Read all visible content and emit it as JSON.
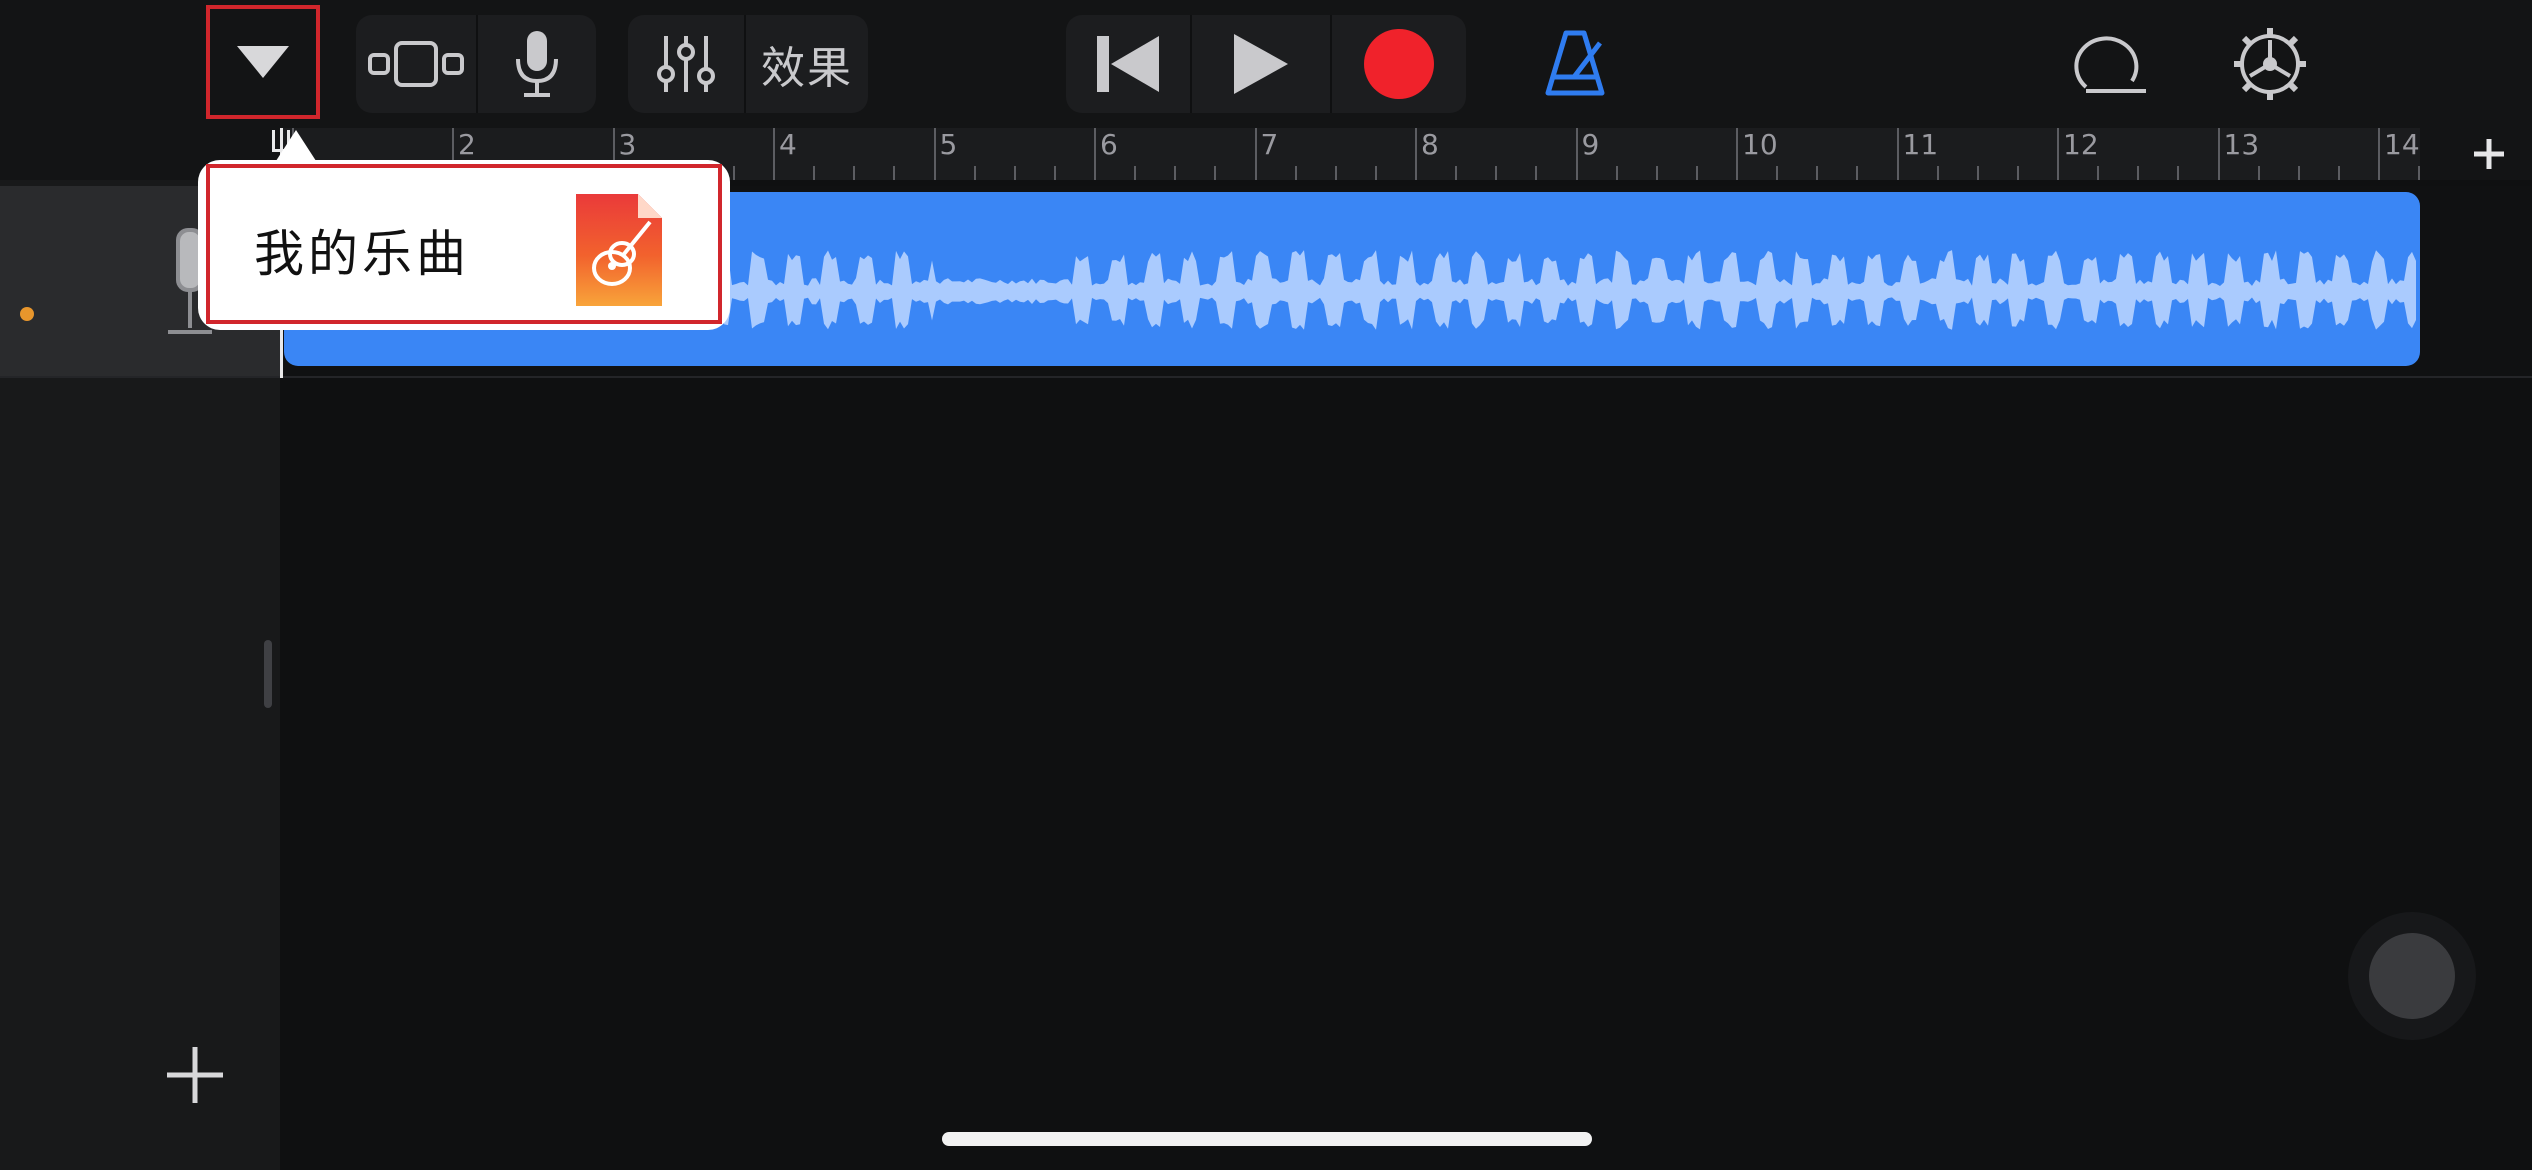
{
  "toolbar": {
    "menu_icon": "triangle-down-icon",
    "tracks_view_icon": "tracks-view-icon",
    "mic_icon": "microphone-icon",
    "mixer_icon": "sliders-icon",
    "effects_label": "效果",
    "rewind_icon": "skip-back-icon",
    "play_icon": "play-icon",
    "record_icon": "record-icon",
    "metronome_icon": "metronome-icon",
    "loop_icon": "loop-icon",
    "settings_icon": "gear-icon"
  },
  "popover": {
    "label": "我的乐曲",
    "icon": "garageband-icon"
  },
  "ruler": {
    "bars": [
      "2",
      "3",
      "4",
      "5",
      "6",
      "7",
      "8",
      "9",
      "10",
      "11",
      "12",
      "13",
      "14"
    ],
    "add_section": "+"
  },
  "track": {
    "instrument_icon": "microphone-instrument-icon",
    "region_color": "#3a86f5"
  },
  "colors": {
    "record": "#f0222b",
    "metronome": "#2f7cf0",
    "highlight": "#d1262c"
  }
}
